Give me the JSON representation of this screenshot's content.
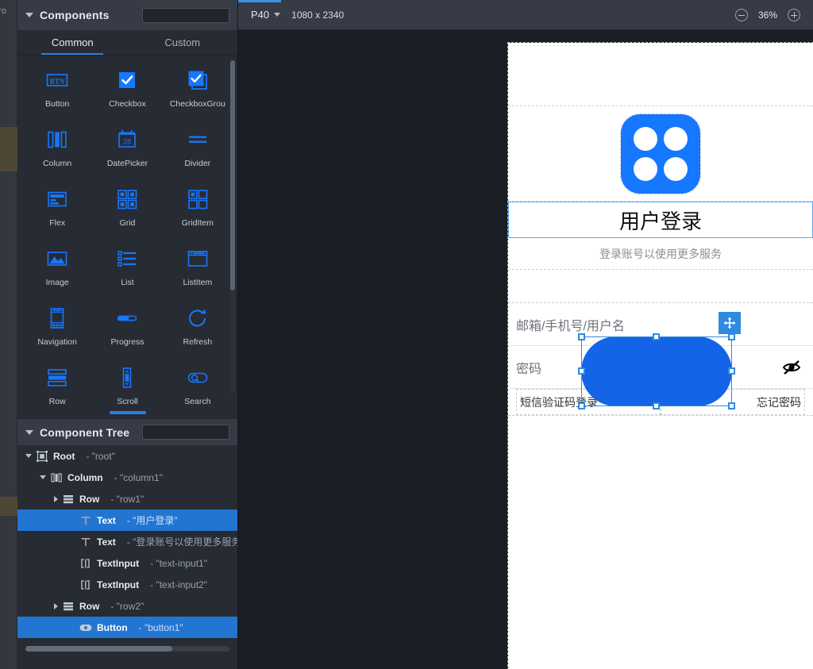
{
  "left_strip": {
    "label": "ro"
  },
  "components_panel": {
    "title": "Components",
    "search_placeholder": "",
    "search_value": "",
    "tabs": [
      {
        "label": "Common",
        "active": true
      },
      {
        "label": "Custom",
        "active": false
      }
    ],
    "items": [
      {
        "label": "Button",
        "icon": "button-icon"
      },
      {
        "label": "Checkbox",
        "icon": "checkbox-icon"
      },
      {
        "label": "CheckboxGrou",
        "icon": "checkbox-group-icon"
      },
      {
        "label": "Column",
        "icon": "column-icon"
      },
      {
        "label": "DatePicker",
        "icon": "date-picker-icon"
      },
      {
        "label": "Divider",
        "icon": "divider-icon"
      },
      {
        "label": "Flex",
        "icon": "flex-icon"
      },
      {
        "label": "Grid",
        "icon": "grid-icon"
      },
      {
        "label": "GridItem",
        "icon": "grid-item-icon"
      },
      {
        "label": "Image",
        "icon": "image-icon"
      },
      {
        "label": "List",
        "icon": "list-icon"
      },
      {
        "label": "ListItem",
        "icon": "list-item-icon"
      },
      {
        "label": "Navigation",
        "icon": "navigation-icon"
      },
      {
        "label": "Progress",
        "icon": "progress-icon"
      },
      {
        "label": "Refresh",
        "icon": "refresh-icon"
      },
      {
        "label": "Row",
        "icon": "row-icon"
      },
      {
        "label": "Scroll",
        "icon": "scroll-icon"
      },
      {
        "label": "Search",
        "icon": "search-icon"
      }
    ],
    "date_picker_day": "28",
    "button_icon_text": "BTN"
  },
  "component_tree": {
    "title": "Component Tree",
    "search_placeholder": "",
    "search_value": "",
    "rows": [
      {
        "name": "Root",
        "id": "- \"root\"",
        "depth": 0,
        "caret": "down",
        "icon": "root-icon",
        "selected": false
      },
      {
        "name": "Column",
        "id": "- \"column1\"",
        "depth": 1,
        "caret": "down",
        "icon": "column-icon",
        "selected": false
      },
      {
        "name": "Row",
        "id": "- \"row1\"",
        "depth": 2,
        "caret": "right",
        "icon": "row-icon",
        "selected": false
      },
      {
        "name": "Text",
        "id": "- \"用户登录\"",
        "depth": 3,
        "caret": "none",
        "icon": "text-icon",
        "selected": true
      },
      {
        "name": "Text",
        "id": "- \"登录账号以使用更多服务\"",
        "depth": 3,
        "caret": "none",
        "icon": "text-icon",
        "selected": false
      },
      {
        "name": "TextInput",
        "id": "- \"text-input1\"",
        "depth": 3,
        "caret": "none",
        "icon": "text-input-icon",
        "selected": false
      },
      {
        "name": "TextInput",
        "id": "- \"text-input2\"",
        "depth": 3,
        "caret": "none",
        "icon": "text-input-icon",
        "selected": false
      },
      {
        "name": "Row",
        "id": "- \"row2\"",
        "depth": 2,
        "caret": "right",
        "icon": "row-icon",
        "selected": false
      },
      {
        "name": "Button",
        "id": "- \"button1\"",
        "depth": 3,
        "caret": "none",
        "icon": "button-pill-icon",
        "selected": true
      }
    ]
  },
  "toolbar": {
    "device_name": "P40",
    "resolution": "1080 x 2340",
    "zoom_level": "36%",
    "zoom_out_label": "−",
    "zoom_in_label": "+"
  },
  "canvas": {
    "page_title": "用户登录",
    "page_subtitle": "登录账号以使用更多服务",
    "username_placeholder": "邮箱/手机号/用户名",
    "password_placeholder": "密码",
    "link_sms": "短信验证码登录",
    "link_forgot": "忘记密码",
    "logo_name": "app-logo",
    "selection_component": "button1"
  },
  "colors": {
    "accent": "#2f7fe0",
    "panel_bg": "#272b33",
    "header_bg": "#373b45",
    "canvas_bg": "#1b1e25",
    "component_icon": "#1677ff",
    "selection_blue": "#1464e8",
    "tree_selected": "#2276d2"
  }
}
